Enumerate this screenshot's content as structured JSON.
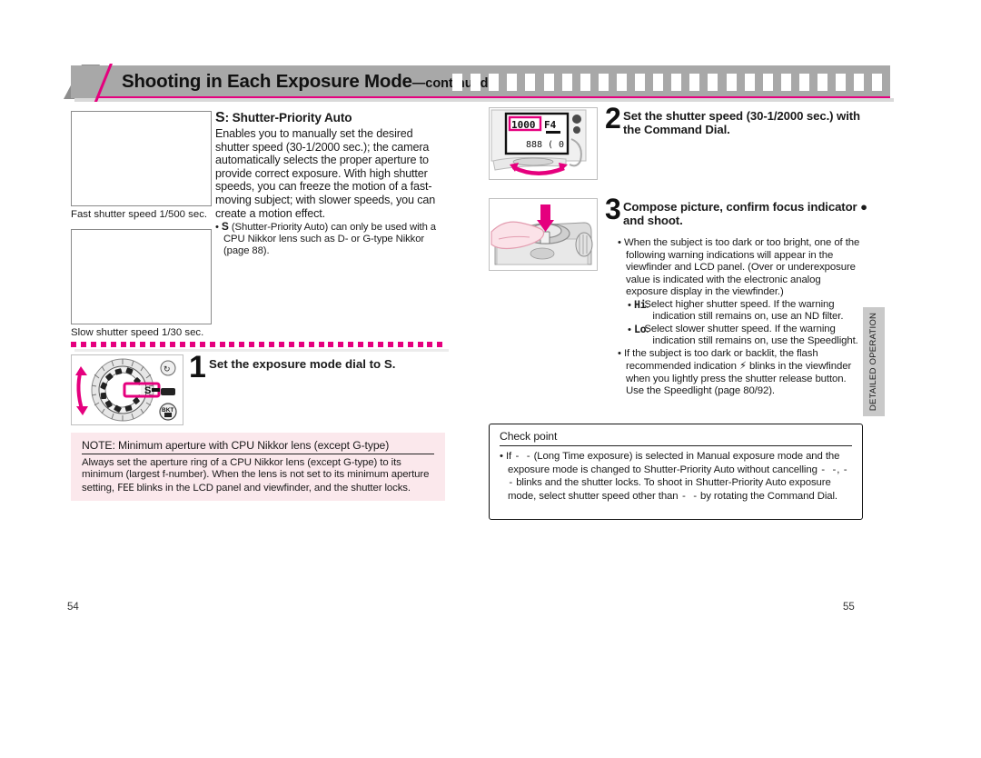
{
  "header": {
    "title": "Shooting in Each Exposure Mode",
    "continued": "—continued"
  },
  "left_column": {
    "photo_captions": [
      "Fast shutter speed  1/500 sec.",
      "Slow shutter speed  1/30 sec."
    ],
    "section": {
      "heading_mode": "S",
      "heading_rest": ": Shutter-Priority Auto",
      "body": "Enables you to manually set the desired shutter speed (30-1/2000 sec.); the camera automatically selects the proper aperture to provide correct exposure. With high shutter speeds, you can freeze the motion of a fast-moving subject; with slower speeds, you can create a motion effect.",
      "bullet_mode": "S",
      "bullet": " (Shutter-Priority Auto) can only be used with a CPU Nikkor lens such as D- or G-type Nikkor (page 88)."
    },
    "step1": {
      "number": "1",
      "text": "Set the exposure mode dial to ",
      "text_bold": "S."
    },
    "note": {
      "title": "NOTE: Minimum aperture with CPU Nikkor lens (except G-type)",
      "body_part1": "Always set the aperture ring of a CPU Nikkor lens (except G-type) to its minimum (largest f-number). When the lens is not set to its minimum aperture setting, ",
      "glyph": "FEE",
      "body_part2": " blinks in the LCD panel and viewfinder, and the shutter locks."
    }
  },
  "right_column": {
    "step2": {
      "number": "2",
      "text": "Set the shutter speed (30-1/2000 sec.) with the Command Dial."
    },
    "step3": {
      "number": "3",
      "text_part1": "Compose picture, confirm focus indicator ",
      "dot": "●",
      "text_part2": " and shoot."
    },
    "bullets": {
      "main": "When the subject is too dark or too bright, one of the following warning indications will appear in the viewfinder and LCD panel. (Over or underexposure value is indicated with the electronic analog exposure display in the viewfinder.)",
      "warnings": [
        {
          "tag": "Hi",
          "suffix": ":",
          "desc": "Select higher shutter speed. If the warning indication still remains on, use an ND filter."
        },
        {
          "tag": "Lo",
          "suffix": ":",
          "desc": "Select slower shutter speed. If the warning indication still remains on, use the Speedlight."
        }
      ],
      "flash_part1": "If the subject is too dark or backlit, the flash recommended indication ",
      "flash_glyph": "⚡",
      "flash_part2": " blinks in the viewfinder when you lightly press the shutter release button. Use the Speedlight (page 80/92)."
    },
    "check_point": {
      "title": "Check point",
      "body_part1": "If ",
      "glyph": "- -",
      "body_part2": " (Long Time exposure) is selected in Manual exposure mode and the exposure mode is changed to Shutter-Priority Auto without cancelling ",
      "glyph2": "- -",
      "body_part3": ", ",
      "glyph3": "- -",
      "body_part4": " blinks and the shutter locks. To shoot in Shutter-Priority Auto exposure mode, select shutter speed other than ",
      "glyph4": "- -",
      "body_part5": " by rotating the Command Dial."
    }
  },
  "side_tab": {
    "label": "DETAILED OPERATION"
  },
  "page_numbers": {
    "left": "54",
    "right": "55"
  },
  "lcd_panel": {
    "shutter_speed": "1000",
    "aperture": "F4",
    "lower_left": "888",
    "lower_right": "0"
  },
  "mode_dial": {
    "selected": "S"
  },
  "colors": {
    "accent_magenta": "#e5007e",
    "header_gray": "#a8a8a8",
    "note_pink": "#fbe8ec",
    "tab_gray": "#c9c9c9"
  }
}
